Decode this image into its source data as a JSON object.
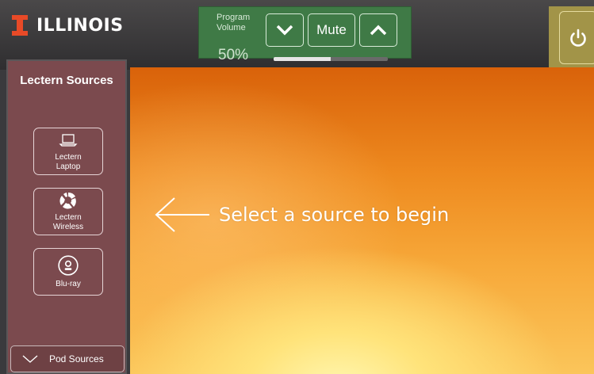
{
  "header": {
    "brand_text": "ILLINOIS",
    "brand_color": "#e84a27"
  },
  "volume": {
    "label_line1": "Program",
    "label_line2": "Volume",
    "mute_label": "Mute",
    "percent_text": "50%",
    "level": 0.5,
    "down_icon": "chevron-down-icon",
    "up_icon": "chevron-up-icon"
  },
  "power": {
    "icon": "power-icon"
  },
  "sidebar": {
    "title": "Lectern Sources",
    "sources": [
      {
        "line1": "Lectern",
        "line2": "Laptop",
        "icon": "laptop-icon"
      },
      {
        "line1": "Lectern",
        "line2": "Wireless",
        "icon": "wireless-icon"
      },
      {
        "line1": "Blu-ray",
        "line2": "",
        "icon": "disc-icon"
      }
    ],
    "pod_label": "Pod Sources"
  },
  "main": {
    "message": "Select a source to begin"
  },
  "colors": {
    "volume_panel": "#3f7a46",
    "power_panel": "#a29448",
    "sidebar": "#7b4a4e"
  }
}
